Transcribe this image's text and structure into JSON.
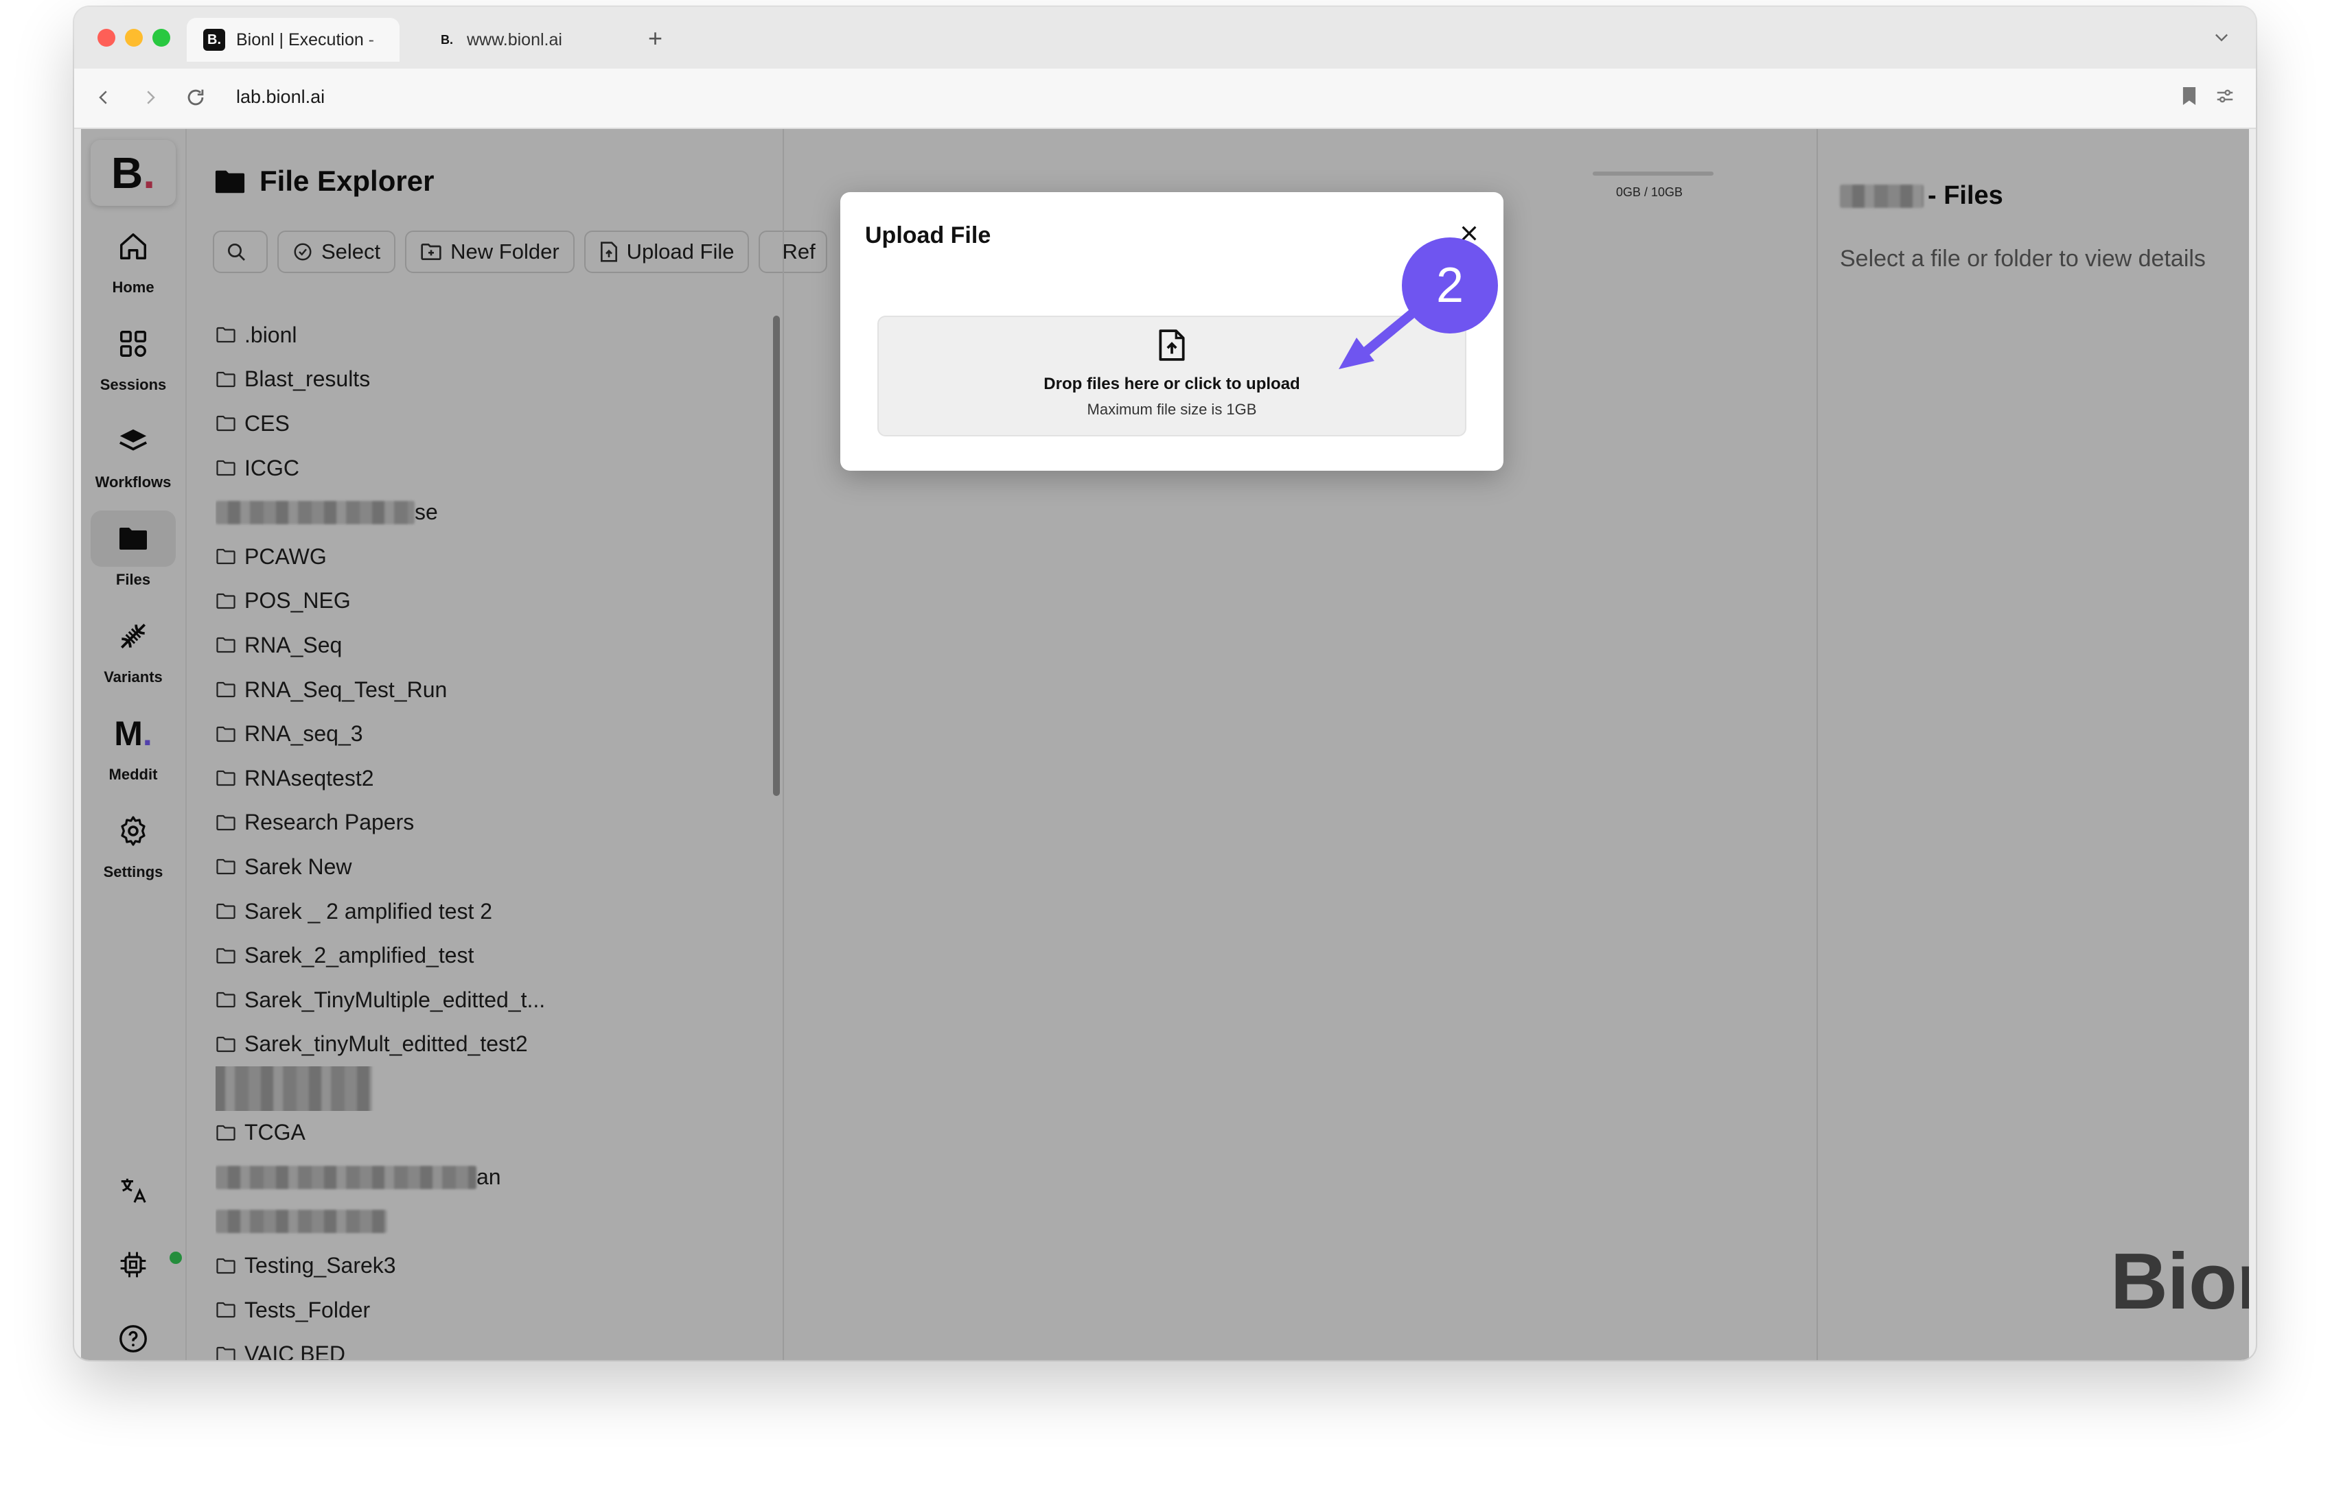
{
  "browser": {
    "active_tab_title": "Bionl | Execution - ",
    "active_tab_favicon": "B.",
    "inactive_tab_title": "www.bionl.ai",
    "inactive_tab_favicon": "B.",
    "new_tab_symbol": "+",
    "url": "lab.bionl.ai"
  },
  "sidebar": {
    "logo_letter": "B",
    "logo_dot": ".",
    "items": [
      {
        "label": "Home",
        "icon": "home-icon"
      },
      {
        "label": "Sessions",
        "icon": "grid-icon"
      },
      {
        "label": "Workflows",
        "icon": "layers-icon"
      },
      {
        "label": "Files",
        "icon": "folder-icon"
      },
      {
        "label": "Variants",
        "icon": "dna-icon"
      },
      {
        "label": "Meddit",
        "icon": "meddit-logo"
      },
      {
        "label": "Settings",
        "icon": "gear-icon"
      }
    ],
    "meddit_letter": "M",
    "meddit_dot": "."
  },
  "file_explorer": {
    "title": "File Explorer",
    "usage": "0GB / 10GB",
    "toolbar": {
      "select": "Select",
      "new_folder": "New Folder",
      "upload_file": "Upload File",
      "refresh": "Ref"
    },
    "folders": [
      ".bionl",
      "Blast_results",
      "CES",
      "ICGC",
      "se",
      "PCAWG",
      "POS_NEG",
      "RNA_Seq",
      "RNA_Seq_Test_Run",
      "RNA_seq_3",
      "RNAseqtest2",
      "Research Papers",
      "Sarek New",
      "Sarek _ 2 amplified test 2",
      "Sarek_2_amplified_test",
      "Sarek_TinyMultiple_editted_t...",
      "Sarek_tinyMult_editted_test2",
      "",
      "TCGA",
      "an",
      "",
      "Testing_Sarek3",
      "Tests_Folder",
      "VAIC BED"
    ]
  },
  "details": {
    "title_suffix": " - Files",
    "placeholder": "Select a file or folder to view details"
  },
  "brand": {
    "name": "Bionl",
    "dot": "."
  },
  "modal": {
    "title": "Upload File",
    "drop_text": "Drop files here or click to upload",
    "max_size_text": "Maximum file size is 1GB"
  },
  "annotation": {
    "step_number": "2",
    "color": "#6f55f0"
  },
  "colors": {
    "accent": "#7b61ff",
    "logo_dot": "#e84363",
    "status_online": "#36d35a"
  }
}
